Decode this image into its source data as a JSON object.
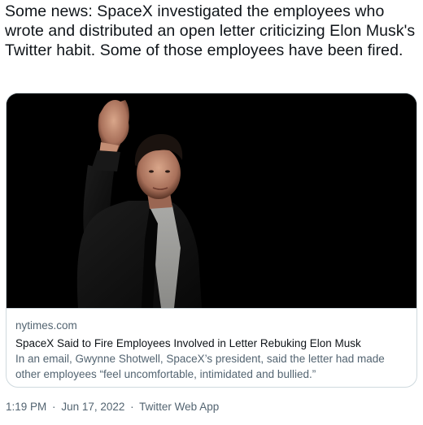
{
  "tweet": {
    "text": "Some news: SpaceX investigated the employees who wrote and distributed an open letter criticizing Elon Musk's Twitter habit. Some of those employees have been fired."
  },
  "card": {
    "domain": "nytimes.com",
    "title": "SpaceX Said to Fire Employees Involved in Letter Rebuking Elon Musk",
    "description": "In an email, Gwynne Shotwell, SpaceX’s president, said the letter had made other employees “feel uncomfortable, intimidated and bullied.”"
  },
  "meta": {
    "time": "1:19 PM",
    "separator": "·",
    "date": "Jun 17, 2022",
    "source": "Twitter Web App"
  },
  "colors": {
    "text_primary": "#0f1419",
    "text_secondary": "#536471",
    "border": "#cfd9de",
    "image_background": "#000000"
  }
}
